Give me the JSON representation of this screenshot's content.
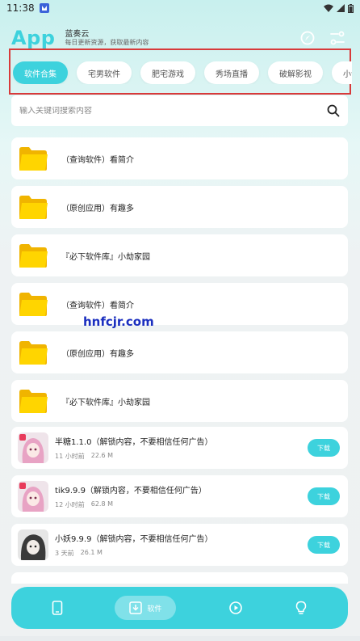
{
  "status": {
    "time": "11:38"
  },
  "header": {
    "brand": "App",
    "name": "蓝奏云",
    "tagline": "每日更新资源，获取最新内容"
  },
  "categories": [
    "软件合集",
    "宅男软件",
    "肥宅游戏",
    "秀场直播",
    "破解影视",
    "小说漫画"
  ],
  "search": {
    "placeholder": "输入关键词搜索内容"
  },
  "folders": [
    "（查询软件）看简介",
    "（原创应用）有趣多",
    "『必下软件库』小劫家园",
    "（查询软件）看简介",
    "（原创应用）有趣多",
    "『必下软件库』小劫家园"
  ],
  "apps": [
    {
      "title": "半糖1.1.0（解锁内容，不要相信任何广告）",
      "time": "11 小时前",
      "size": "22.6 M",
      "button": "下载"
    },
    {
      "title": "tik9.9.9（解锁内容，不要相信任何广告）",
      "time": "12 小时前",
      "size": "62.8 M",
      "button": "下载"
    },
    {
      "title": "小妖9.9.9（解锁内容，不要相信任何广告）",
      "time": "3 天前",
      "size": "26.1 M",
      "button": "下载"
    }
  ],
  "watermark": "hnfcjr.com",
  "nav": {
    "software_label": "软件"
  },
  "colors": {
    "accent": "#3dd2dd",
    "highlight_box": "#d83a3a",
    "folder": "#ffd500"
  }
}
